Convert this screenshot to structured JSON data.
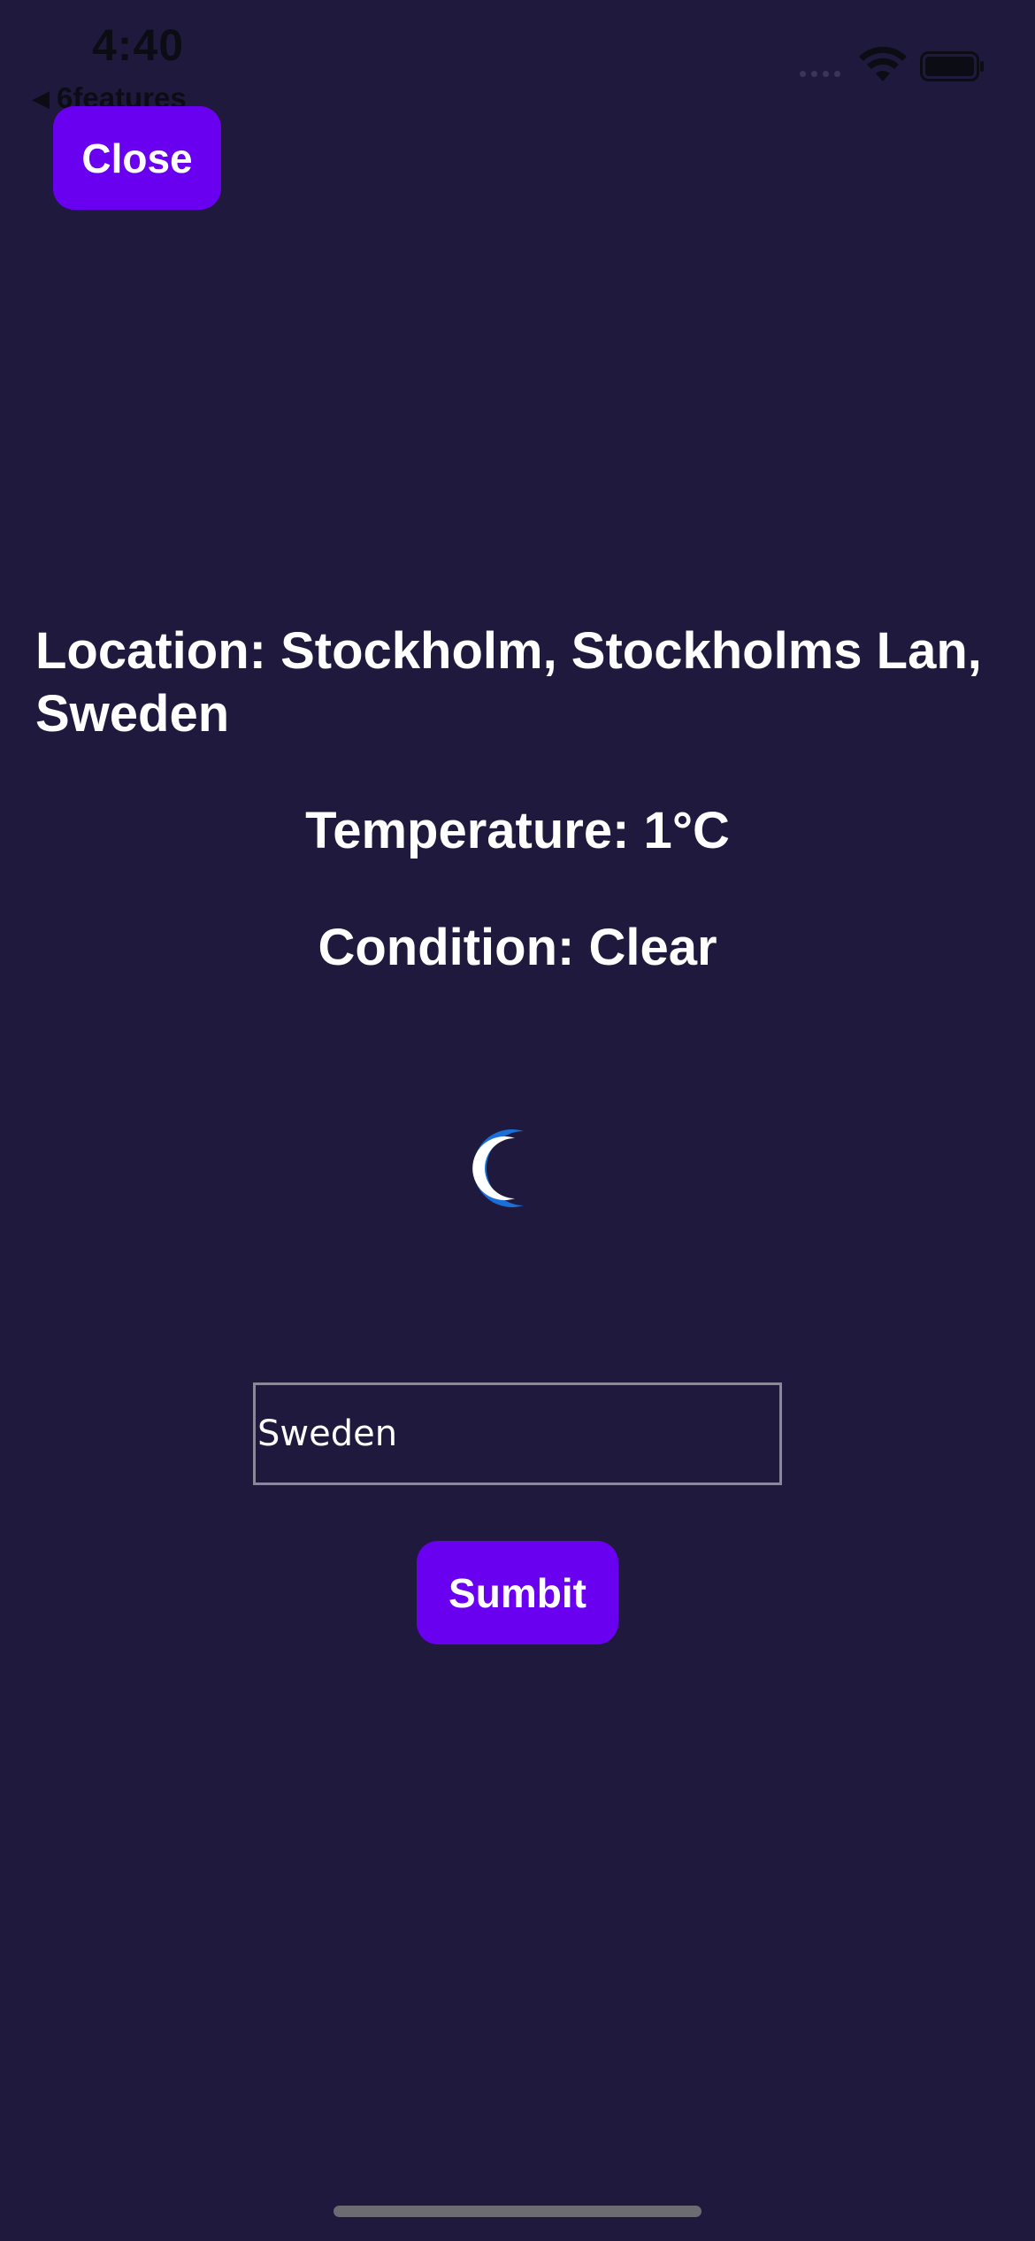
{
  "status_bar": {
    "time": "4:40",
    "back_label": "6features",
    "back_icon": "back-triangle-icon",
    "wifi_icon": "wifi-icon",
    "battery_icon": "battery-icon"
  },
  "header": {
    "close_label": "Close"
  },
  "weather": {
    "location": "Location: Stockholm, Stockholms Lan, Sweden",
    "temperature": "Temperature: 1°C",
    "condition": "Condition: Clear",
    "condition_icon": "moon-icon"
  },
  "form": {
    "input_value": "Sweden",
    "submit_label": "Sumbit"
  },
  "colors": {
    "background": "#1f1a3d",
    "button": "#6a00f0",
    "text": "#ffffff",
    "moon": "#1a6fd8"
  }
}
